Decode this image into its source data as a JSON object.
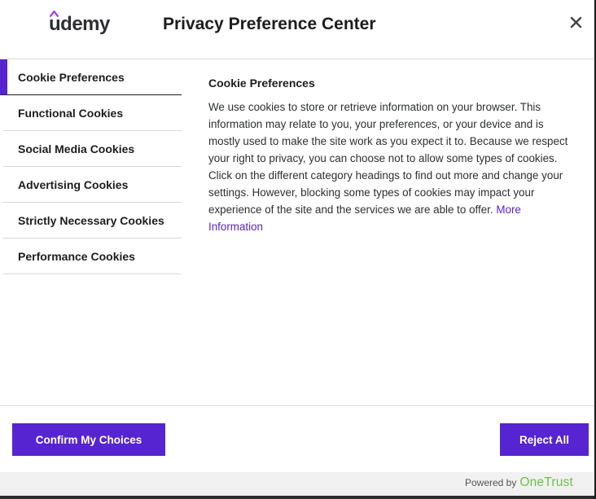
{
  "header": {
    "logo_text": "udemy",
    "title": "Privacy Preference Center",
    "close_icon": "close-icon"
  },
  "sidebar": {
    "items": [
      {
        "label": "Cookie Preferences",
        "active": true
      },
      {
        "label": "Functional Cookies",
        "active": false
      },
      {
        "label": "Social Media Cookies",
        "active": false
      },
      {
        "label": "Advertising Cookies",
        "active": false
      },
      {
        "label": "Strictly Necessary Cookies",
        "active": false
      },
      {
        "label": "Performance Cookies",
        "active": false
      }
    ]
  },
  "content": {
    "title": "Cookie Preferences",
    "body": "We use cookies to store or retrieve information on your browser. This information may relate to you, your preferences, or your device and is mostly used to make the site work as you expect it to. Because we respect your right to privacy, you can choose not to allow some types of cookies. Click on the different category headings to find out more and change your settings. However, blocking some types of cookies may impact your experience of the site and the services we are able to offer.",
    "more_link": "More Information"
  },
  "footer": {
    "confirm_label": "Confirm My Choices",
    "reject_label": "Reject All"
  },
  "powered": {
    "label": "Powered by",
    "brand": "OneTrust"
  },
  "colors": {
    "accent": "#5624d0",
    "onetrust_green": "#6cc04a",
    "text": "#1c1d1f"
  }
}
